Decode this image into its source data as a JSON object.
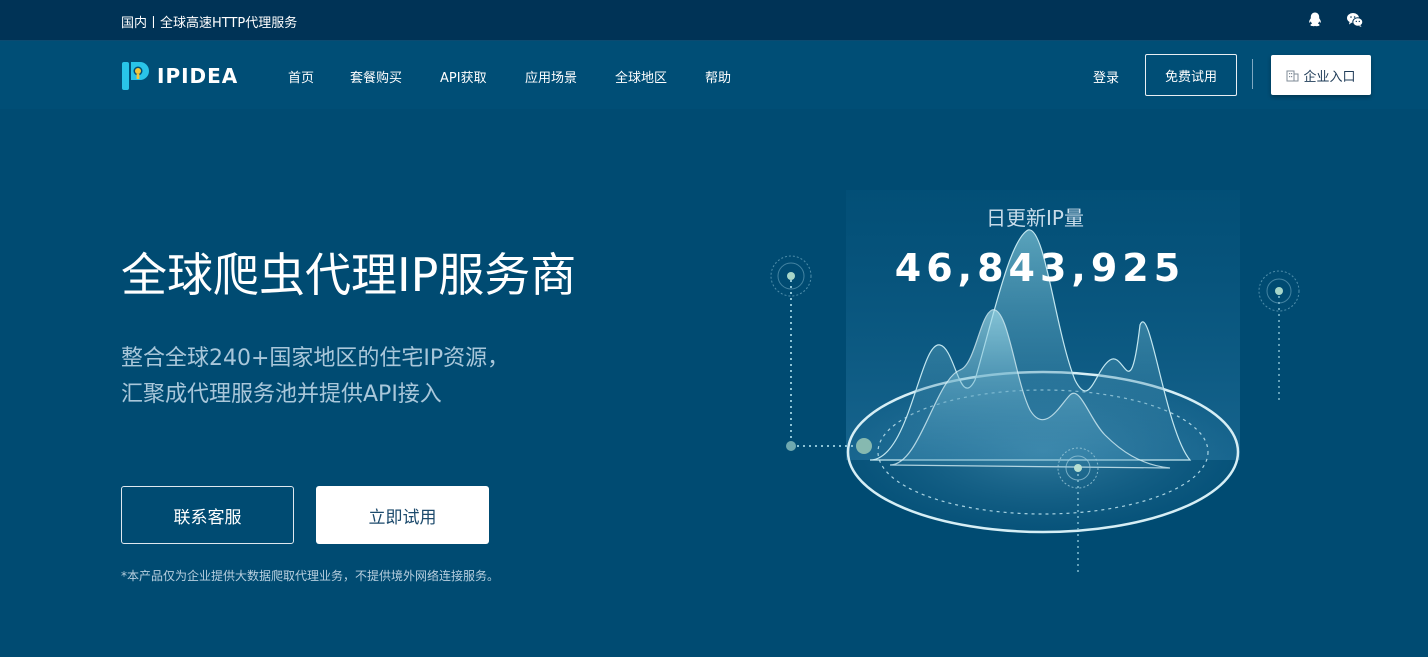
{
  "topbar": {
    "region_text": "国内丨全球高速HTTP代理服务",
    "icons": [
      "qq-icon",
      "wechat-icon"
    ]
  },
  "nav": {
    "logo_text": "IPIDEA",
    "menu": [
      "首页",
      "套餐购买",
      "API获取",
      "应用场景",
      "全球地区",
      "帮助"
    ],
    "login_label": "登录",
    "trial_label": "免费试用",
    "enterprise_label": "企业入口"
  },
  "hero": {
    "title": "全球爬虫代理IP服务商",
    "subtitle_line1": "整合全球240+国家地区的住宅IP资源，",
    "subtitle_line2": "汇聚成代理服务池并提供API接入",
    "contact_label": "联系客服",
    "try_label": "立即试用",
    "disclaimer": "*本产品仅为企业提供大数据爬取代理业务，不提供境外网络连接服务。"
  },
  "stats": {
    "label": "日更新IP量",
    "count": "46,843,925"
  },
  "colors": {
    "background": "#004b72",
    "topbar": "#003356",
    "accent_cyan": "#29c4e8",
    "accent_yellow": "#f3c63a"
  }
}
